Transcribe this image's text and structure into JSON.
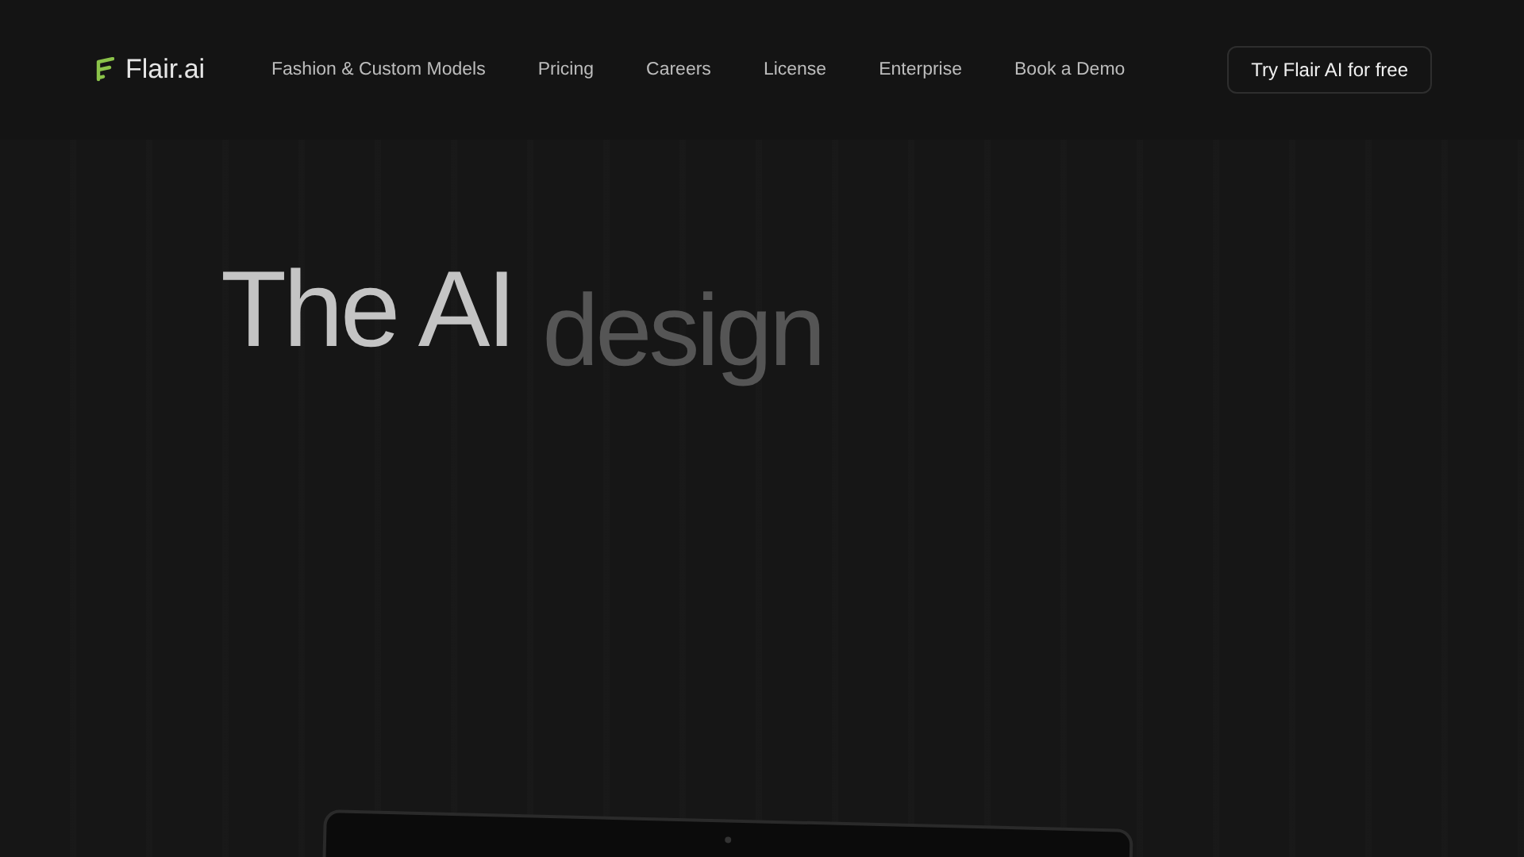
{
  "brand": {
    "name": "Flair.ai"
  },
  "nav": {
    "links": [
      "Fashion & Custom Models",
      "Pricing",
      "Careers",
      "License",
      "Enterprise",
      "Book a Demo"
    ],
    "cta": "Try Flair AI for free"
  },
  "hero": {
    "headline": [
      {
        "text": "The AI",
        "kind": "bright"
      },
      {
        "text": "design",
        "kind": "dim"
      }
    ]
  }
}
